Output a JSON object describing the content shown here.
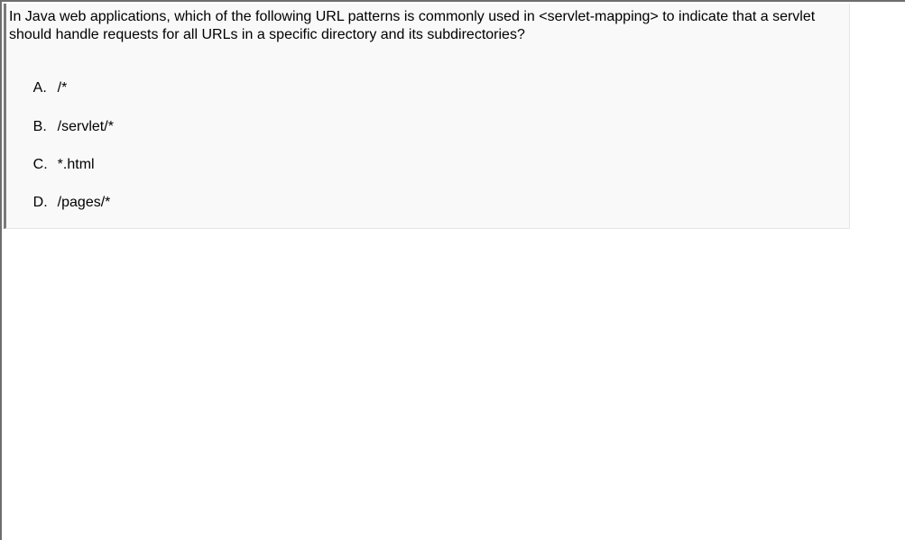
{
  "question": {
    "text": "In Java web applications, which of the following URL patterns is commonly used in <servlet-mapping> to indicate that a servlet should handle requests for all URLs in a specific directory and its subdirectories?"
  },
  "options": [
    {
      "letter": "A.",
      "text": "/*"
    },
    {
      "letter": "B.",
      "text": "/servlet/*"
    },
    {
      "letter": "C.",
      "text": "*.html"
    },
    {
      "letter": "D.",
      "text": "/pages/*"
    }
  ]
}
